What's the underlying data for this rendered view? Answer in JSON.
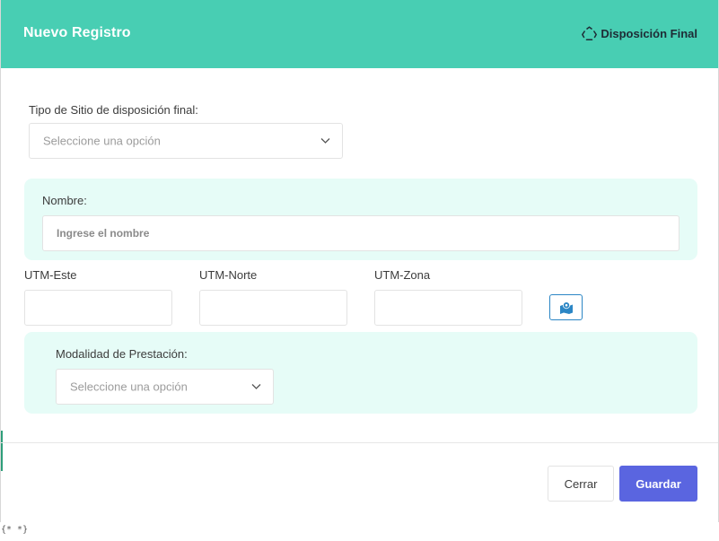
{
  "header": {
    "title": "Nuevo Registro",
    "section_icon": "recycle-icon",
    "section_label": "Disposición Final"
  },
  "form": {
    "site_type": {
      "label": "Tipo de Sitio de disposición final:",
      "placeholder": "Seleccione una opción"
    },
    "name": {
      "label": "Nombre:",
      "placeholder": "Ingrese el nombre",
      "value": ""
    },
    "utm_este": {
      "label": "UTM-Este",
      "value": ""
    },
    "utm_norte": {
      "label": "UTM-Norte",
      "value": ""
    },
    "utm_zona": {
      "label": "UTM-Zona",
      "value": ""
    },
    "map_button_icon": "map-pin-icon",
    "modality": {
      "label": "Modalidad de Prestación:",
      "placeholder": "Seleccione una opción"
    }
  },
  "footer": {
    "close_label": "Cerrar",
    "save_label": "Guardar"
  },
  "corner_text": "{* *}",
  "colors": {
    "header_bg": "#48ceb3",
    "panel_bg": "#e6fcf7",
    "primary": "#5a65e0",
    "map_button_border": "#2b86c5"
  }
}
